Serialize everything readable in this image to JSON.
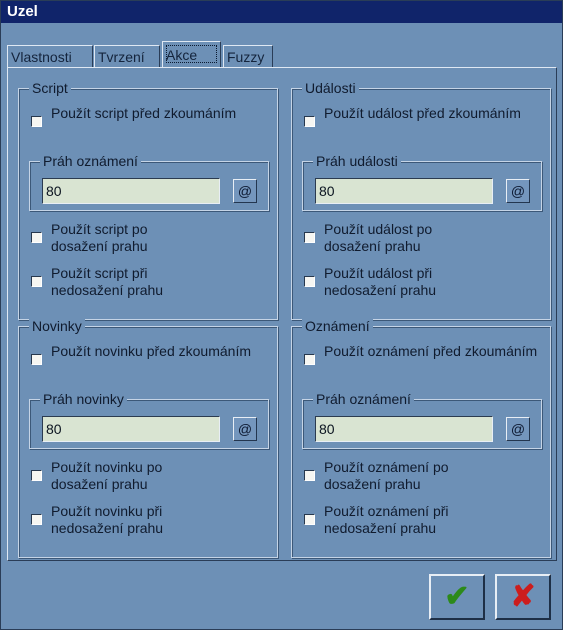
{
  "window": {
    "title": "Uzel"
  },
  "tabs": [
    {
      "label": "Vlastnosti"
    },
    {
      "label": "Tvrzení"
    },
    {
      "label": "Akce"
    },
    {
      "label": "Fuzzy"
    }
  ],
  "groups": {
    "script": {
      "title": "Script",
      "before": "Použít script před zkoumáním",
      "threshold_title": "Práh oznámení",
      "threshold_value": "80",
      "at_symbol": "@",
      "reached": "Použít script po dosažení prahu",
      "not_reached": "Použít script při nedosažení prahu"
    },
    "udalosti": {
      "title": "Události",
      "before": "Použít událost před zkoumáním",
      "threshold_title": "Práh události",
      "threshold_value": "80",
      "at_symbol": "@",
      "reached": "Použít událost po dosažení prahu",
      "not_reached": "Použít událost při nedosažení prahu"
    },
    "novinky": {
      "title": "Novinky",
      "before": "Použít novinku před zkoumáním",
      "threshold_title": "Práh novinky",
      "threshold_value": "80",
      "at_symbol": "@",
      "reached": "Použít novinku po dosažení prahu",
      "not_reached": "Použít novinku při nedosažení prahu"
    },
    "oznameni": {
      "title": "Oznámení",
      "before": "Použít oznámení před zkoumáním",
      "threshold_title": "Práh oznámení",
      "threshold_value": "80",
      "at_symbol": "@",
      "reached": "Použít oznámení po dosažení prahu",
      "not_reached": "Použít oznámení při nedosažení prahu"
    }
  },
  "buttons": {
    "ok_icon": "checkmark-icon",
    "ok_glyph": "✔",
    "cancel_icon": "cross-icon",
    "cancel_glyph": "✘"
  },
  "colors": {
    "titlebar": "#10246a",
    "background": "#6d90b6",
    "input": "#d9e4d2",
    "ok": "#2c8a1a",
    "cancel": "#cc1d1d"
  }
}
